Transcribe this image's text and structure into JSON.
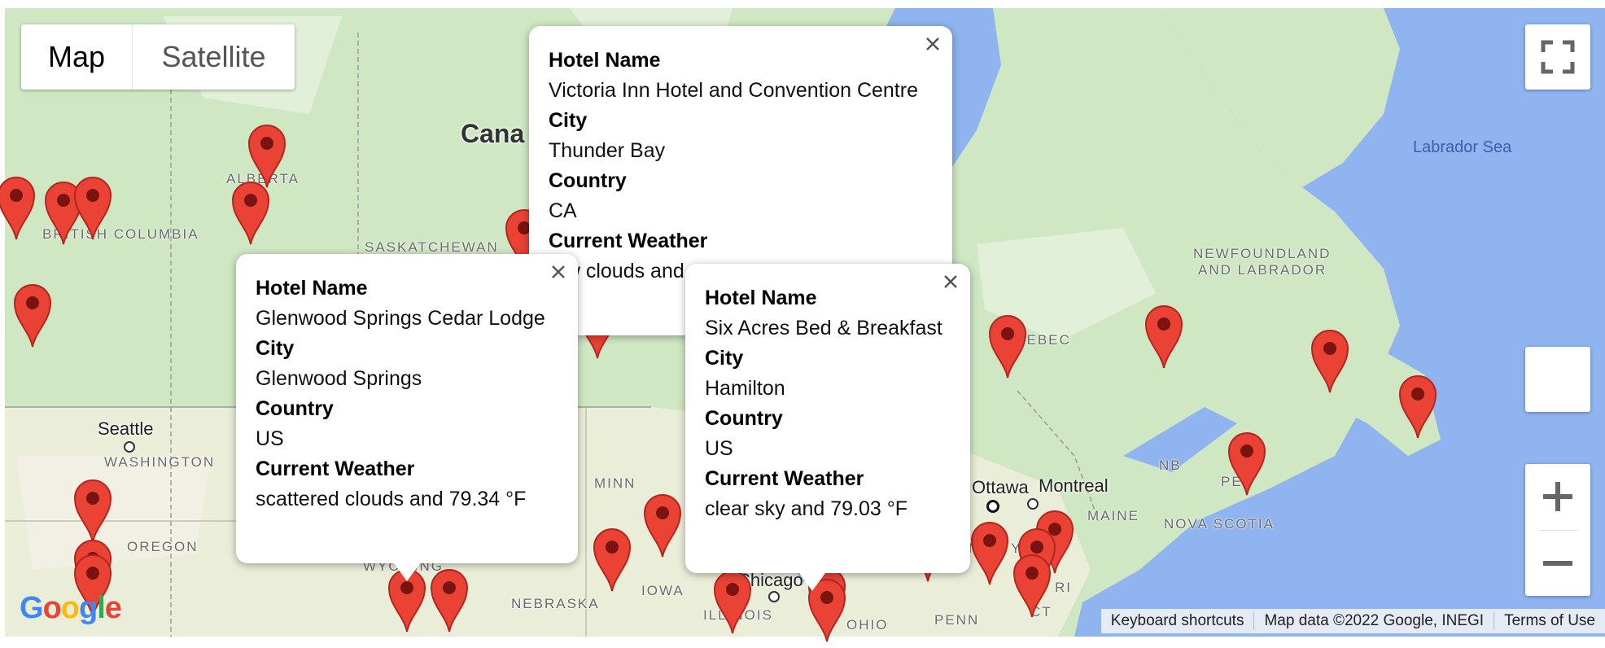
{
  "map_type": {
    "options": [
      "Map",
      "Satellite"
    ],
    "selected": "Map"
  },
  "labels": {
    "country": "Cana",
    "regions": [
      "BRITISH COLUMBIA",
      "ALBERTA",
      "SASKATCHEWAN",
      "WASHINGTON",
      "OREGON",
      "WYOMING",
      "NEBRASKA",
      "IOWA",
      "MINN",
      "ILLINOIS",
      "OHIO",
      "PENN",
      "MAINE",
      "NB",
      "PEI",
      "NOVA SCOTIA",
      "QUEBEC",
      "NEWFOUNDLAND",
      "AND LABRADOR",
      "CT",
      "RI",
      "NEW YORK"
    ],
    "cities": [
      "Seattle",
      "Chicago",
      "Montreal",
      "Ottawa"
    ],
    "sea": "Labrador Sea"
  },
  "info_windows": [
    {
      "hotel_label": "Hotel Name",
      "hotel": "Victoria Inn Hotel and Convention Centre",
      "city_label": "City",
      "city": "Thunder Bay",
      "country_label": "Country",
      "country": "CA",
      "weather_label": "Current Weather",
      "weather": "few clouds and"
    },
    {
      "hotel_label": "Hotel Name",
      "hotel": "Glenwood Springs Cedar Lodge",
      "city_label": "City",
      "city": "Glenwood Springs",
      "country_label": "Country",
      "country": "US",
      "weather_label": "Current Weather",
      "weather": "scattered clouds and 79.34 °F"
    },
    {
      "hotel_label": "Hotel Name",
      "hotel": "Six Acres Bed & Breakfast",
      "city_label": "City",
      "city": "Hamilton",
      "country_label": "Country",
      "country": "US",
      "weather_label": "Current Weather",
      "weather": "clear sky and 79.03 °F"
    }
  ],
  "attribution": {
    "keyboard": "Keyboard shortcuts",
    "map_data": "Map data ©2022 Google, INEGI",
    "terms": "Terms of Use"
  },
  "logo_text": "Google",
  "colors": {
    "land": "#cfe8c3",
    "land_light": "#e3f0d9",
    "water": "#8fb4ef",
    "us_land": "#eaeed9",
    "pin": "#ea4335",
    "pin_dot": "#7a1410"
  },
  "icons": [
    "fullscreen-icon",
    "close-icon",
    "zoom-in-icon",
    "zoom-out-icon",
    "marker-icon"
  ]
}
